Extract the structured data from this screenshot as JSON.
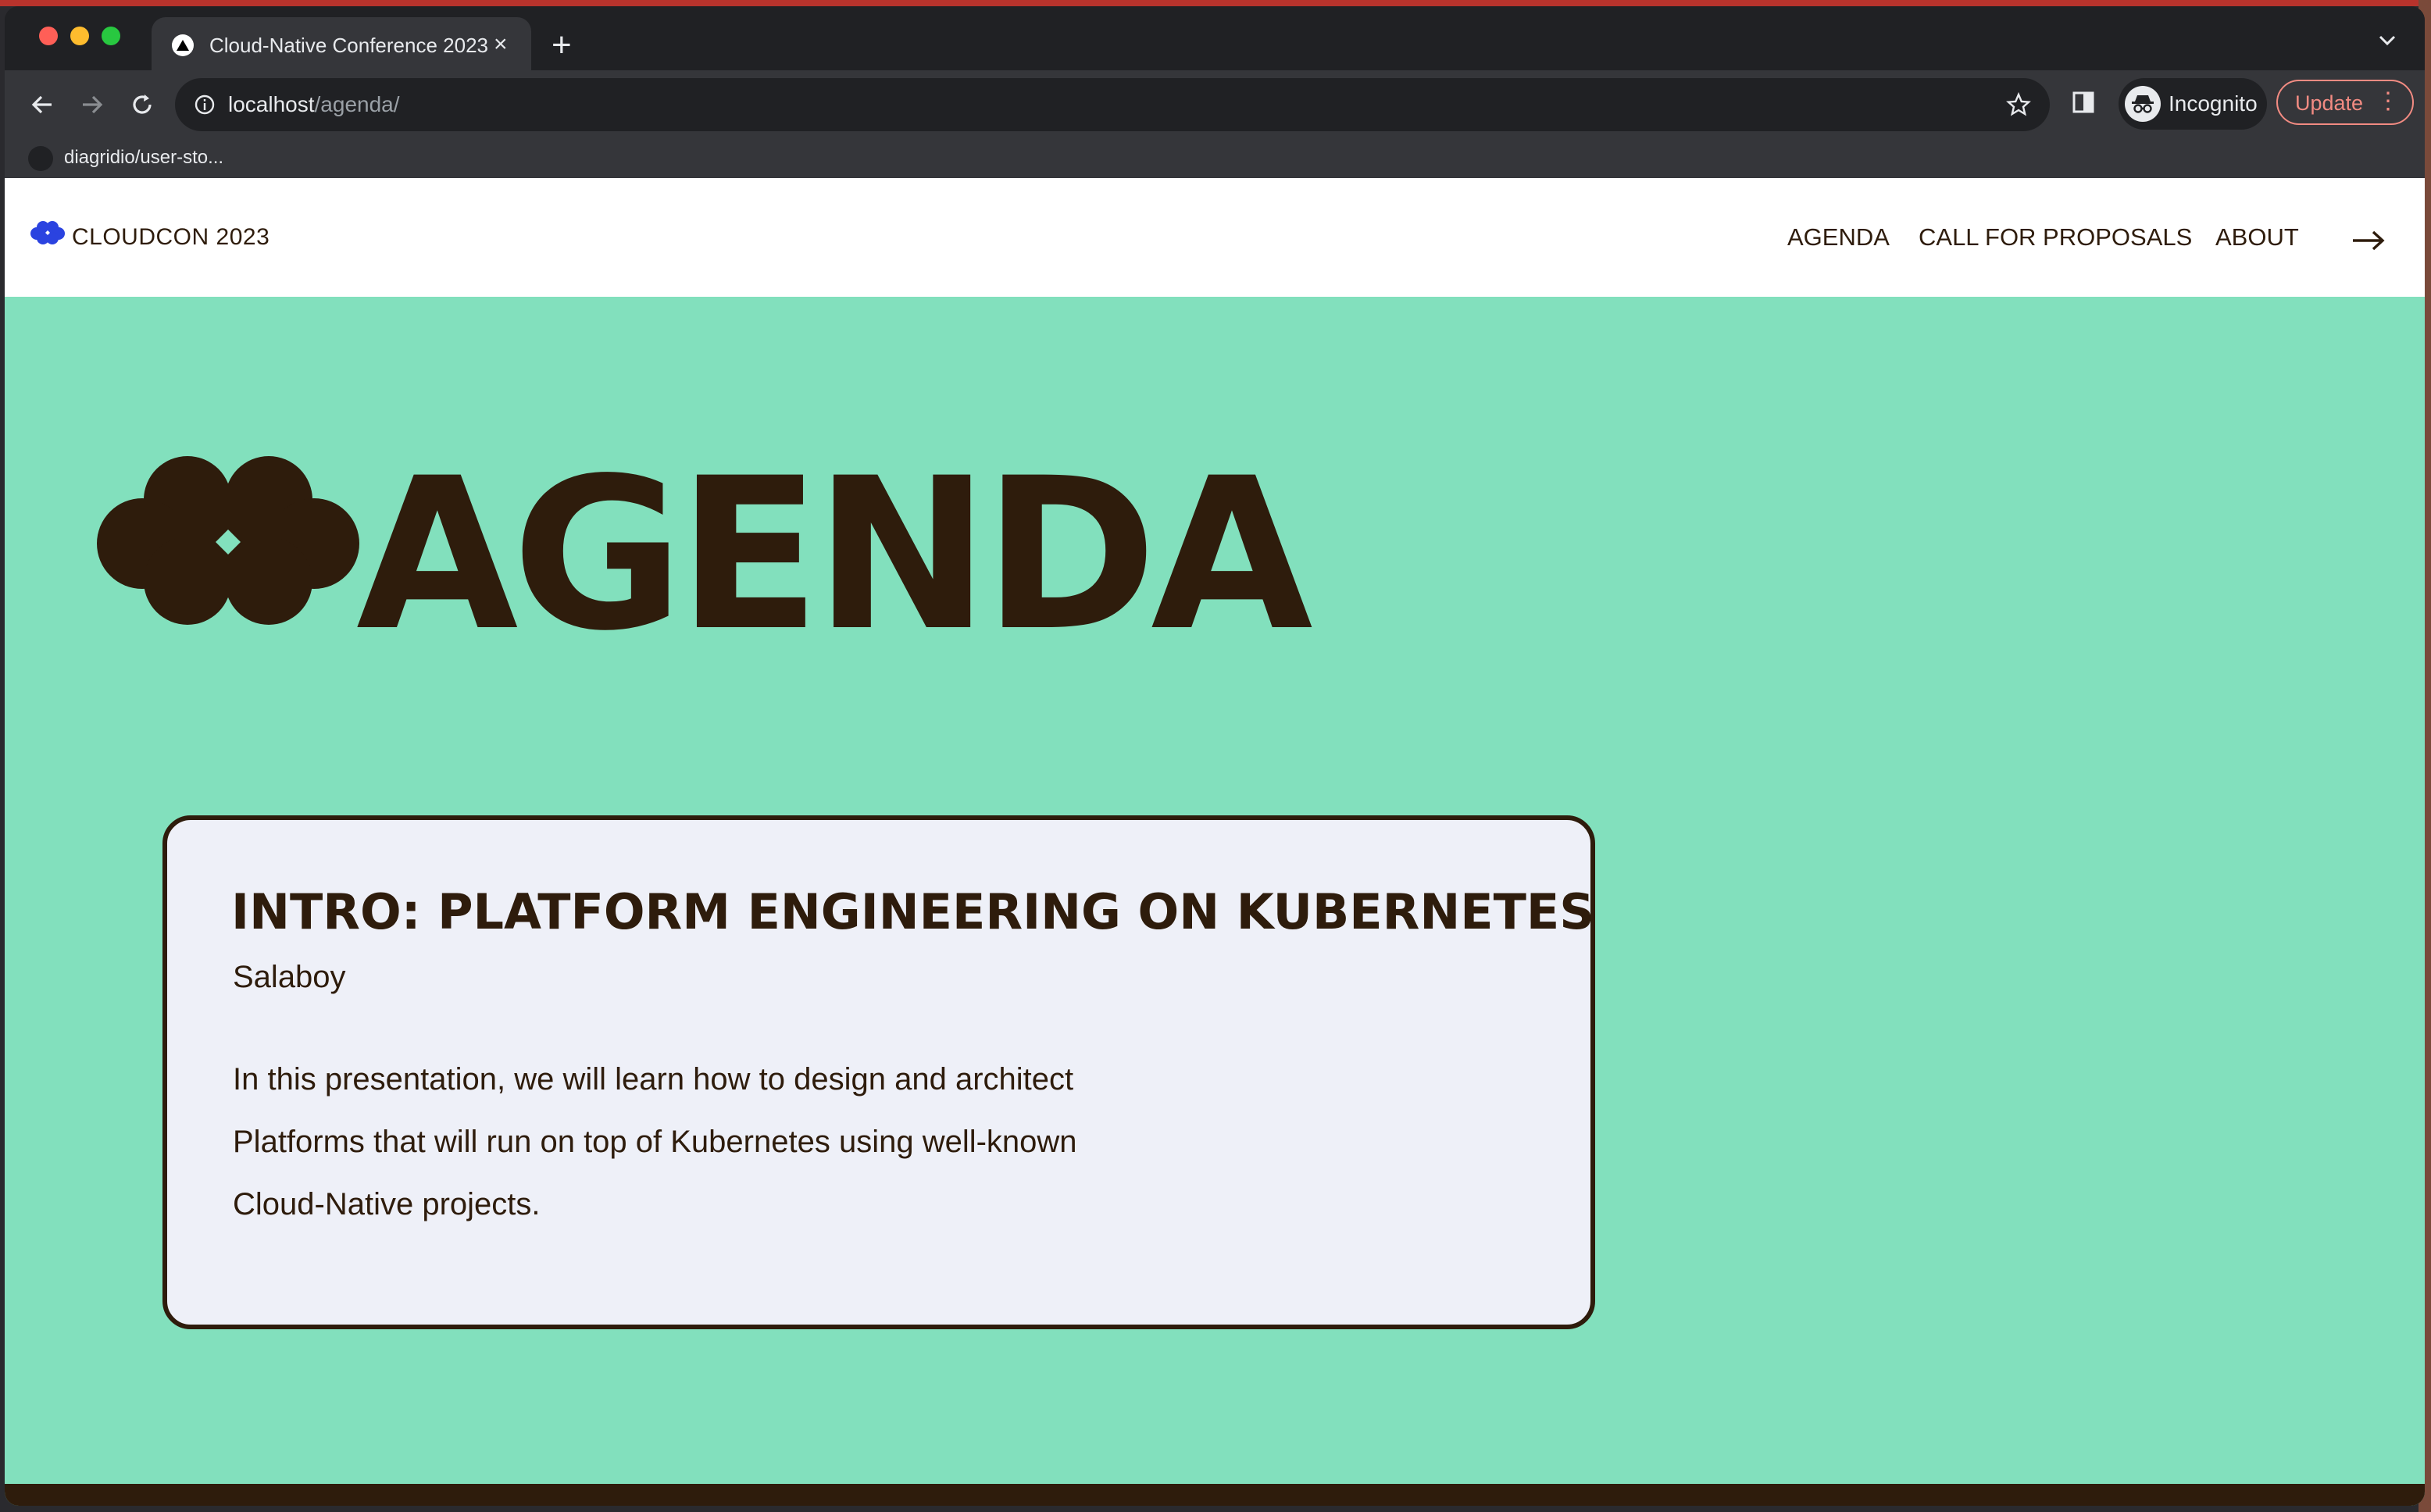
{
  "browser": {
    "tab": {
      "title": "Cloud-Native Conference 2023",
      "close_glyph": "×",
      "favicon": "triangle-logo-icon"
    },
    "new_tab_glyph": "+",
    "address": {
      "host": "localhost",
      "path": "/agenda/"
    },
    "incognito_label": "Incognito",
    "update_label": "Update",
    "menu_glyph": "⋮",
    "bookmark": {
      "label": "diagridio/user-sto..."
    }
  },
  "site": {
    "brand": "CLOUDCON 2023",
    "nav": [
      "AGENDA",
      "CALL FOR PROPOSALS",
      "ABOUT"
    ],
    "page_heading": "AGENDA",
    "talk": {
      "title": "INTRO: PLATFORM ENGINEERING ON KUBERNETES",
      "speaker": "Salaboy",
      "description_lines": [
        "In this presentation, we will learn how to design and architect",
        "Platforms that will run on top of Kubernetes using well-known",
        "Cloud-Native projects."
      ]
    }
  },
  "colors": {
    "page_background": "#82e0bd",
    "ink": "#2e1c0c",
    "card_background": "#eef0f8",
    "logo_blue": "#2b43e0",
    "browser_dark": "#202124",
    "browser_toolbar": "#35363a"
  }
}
